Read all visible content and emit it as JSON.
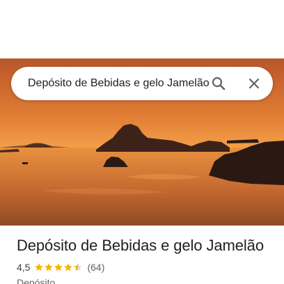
{
  "search": {
    "value": "Depósito de Bebidas e gelo Jamelão",
    "search_icon": "search-icon",
    "close_icon": "close-icon"
  },
  "hero": {
    "image": "sunset-bay-photo"
  },
  "place": {
    "title": "Depósito de Bebidas e gelo Jamelão",
    "rating": "4,5",
    "rating_stars": 4.5,
    "reviews": "(64)",
    "category": "Depósito"
  },
  "colors": {
    "star": "#f4b400",
    "text_primary": "#202124",
    "text_secondary": "#5f6368"
  }
}
